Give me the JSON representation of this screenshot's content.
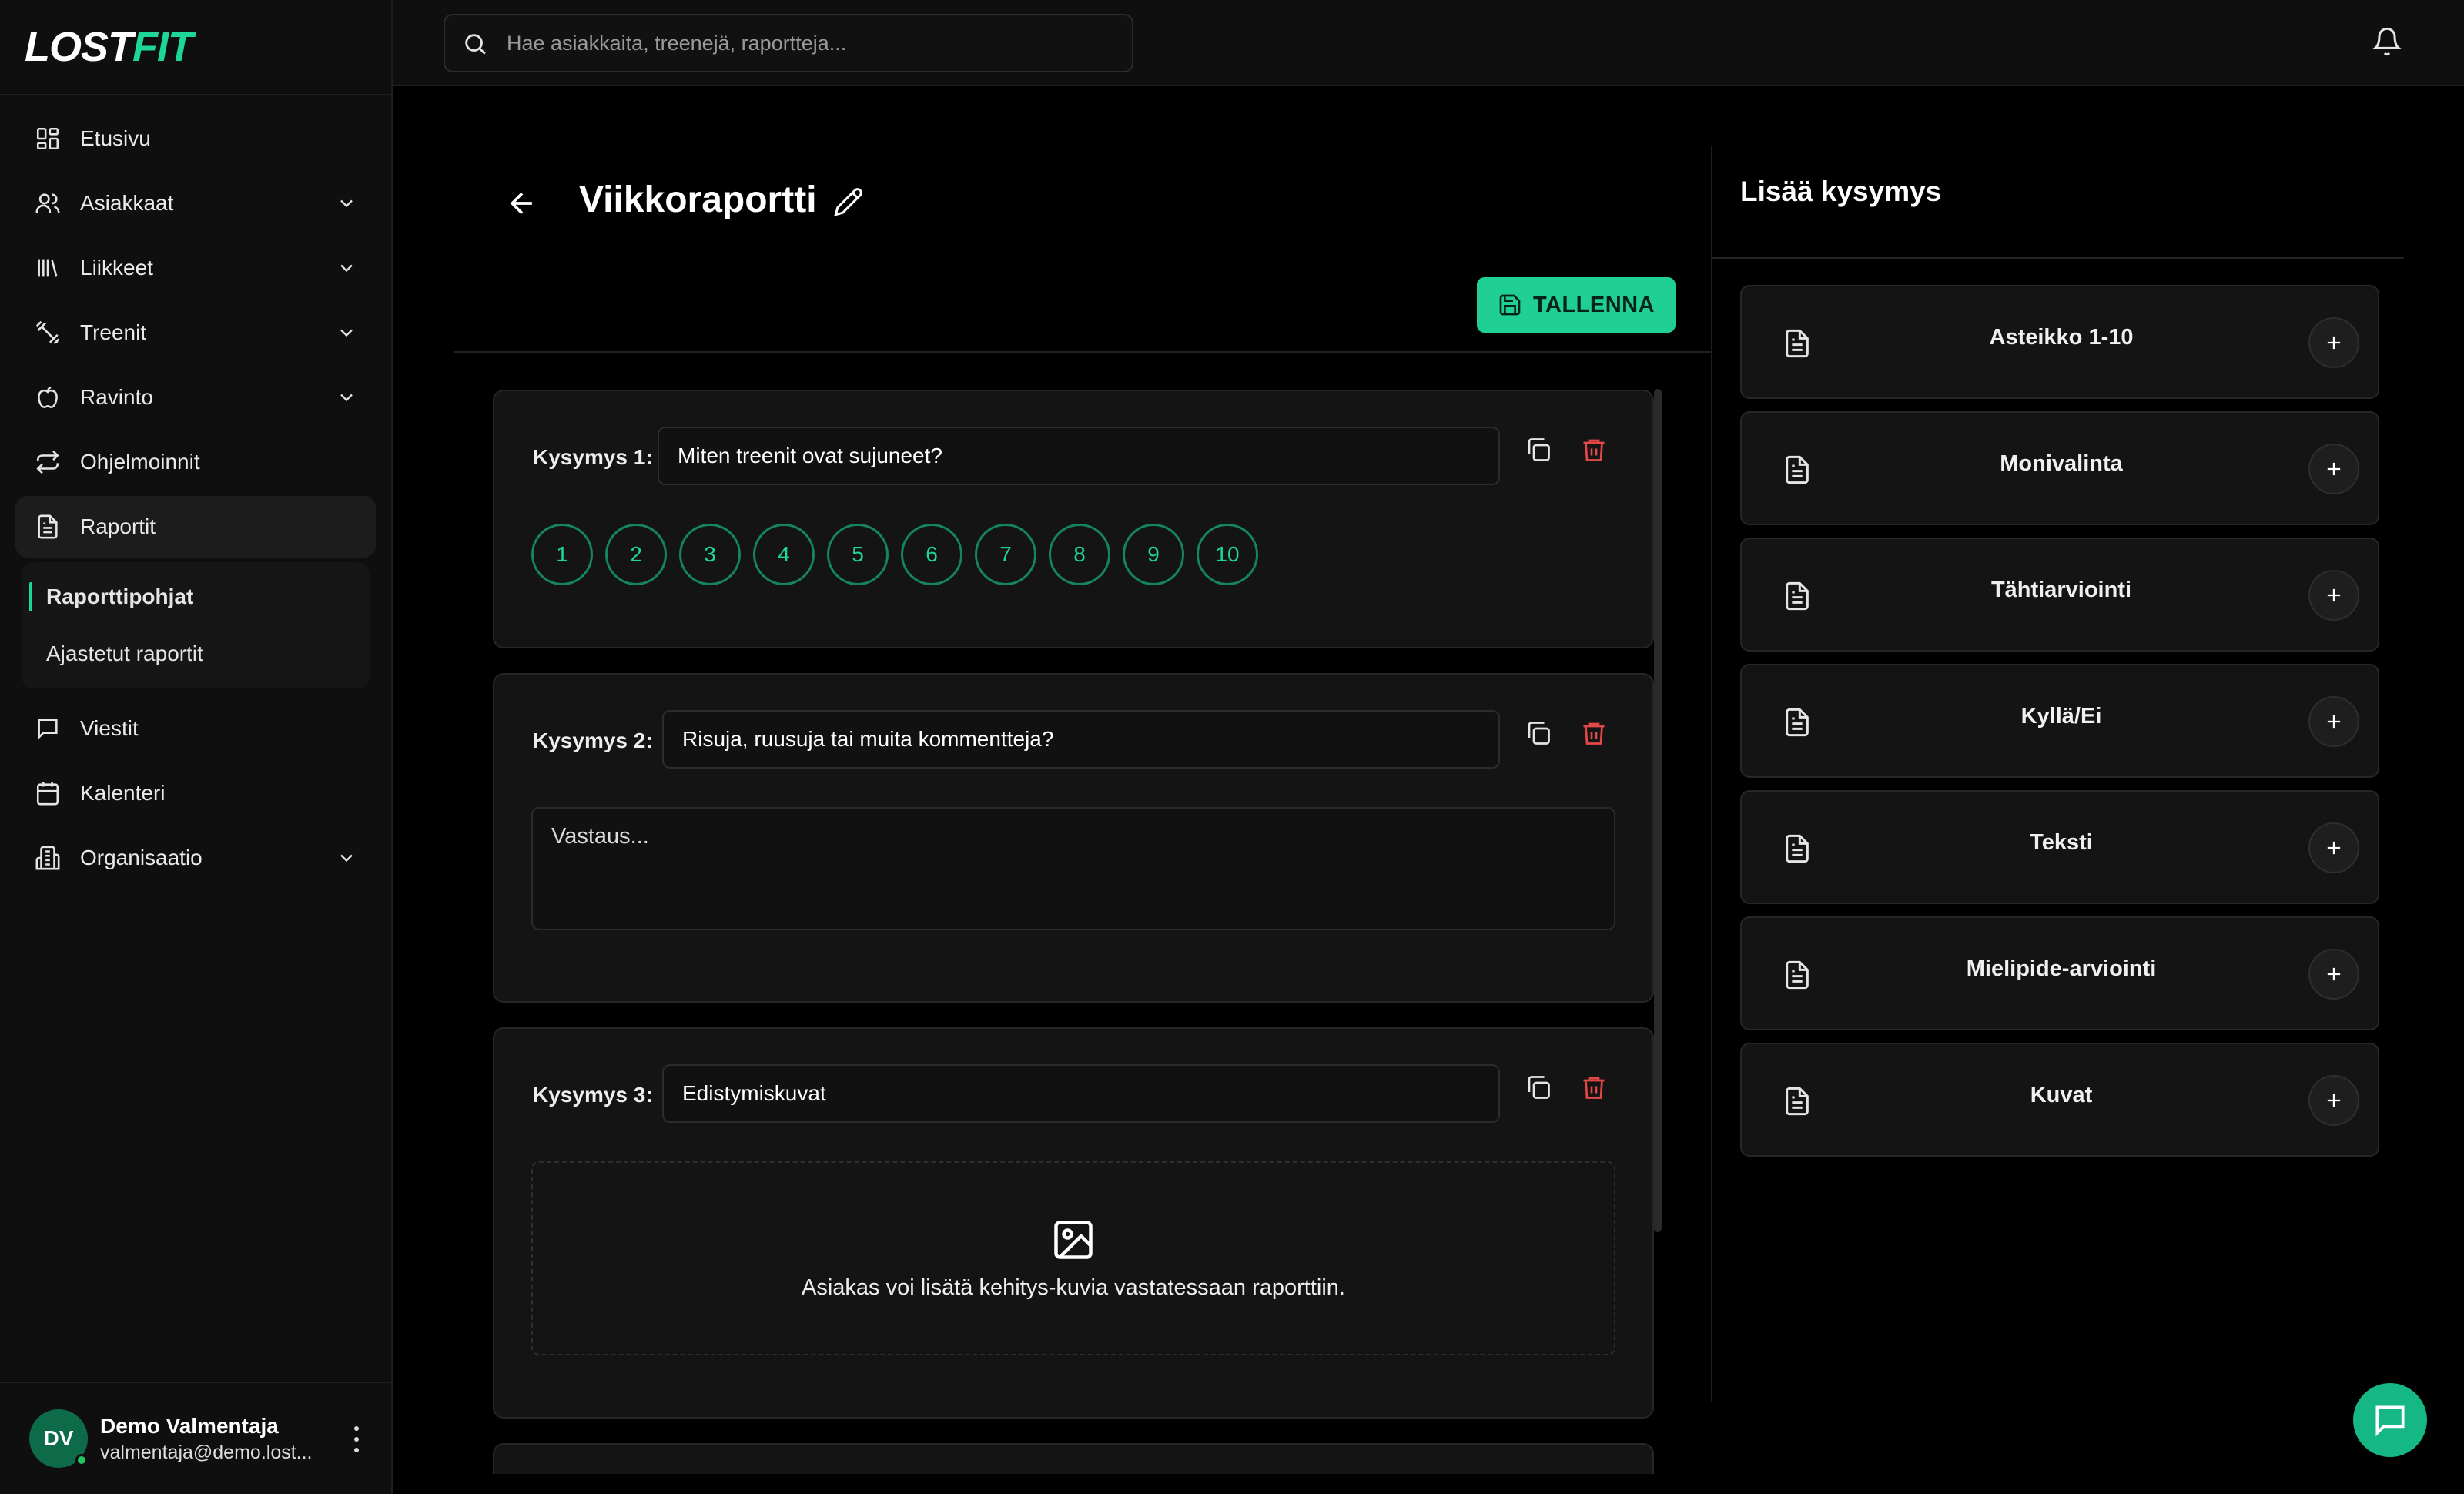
{
  "brand": {
    "lost": "LOST",
    "fit": "FIT",
    "accent": "#1fd69a"
  },
  "search": {
    "placeholder": "Hae asiakkaita, treenejä, raportteja..."
  },
  "sidebar": {
    "items": [
      {
        "label": "Etusivu",
        "icon": "dashboard-icon"
      },
      {
        "label": "Asiakkaat",
        "icon": "users-icon",
        "expandable": true
      },
      {
        "label": "Liikkeet",
        "icon": "library-icon",
        "expandable": true
      },
      {
        "label": "Treenit",
        "icon": "dumbbell-icon",
        "expandable": true
      },
      {
        "label": "Ravinto",
        "icon": "apple-icon",
        "expandable": true
      },
      {
        "label": "Ohjelmoinnit",
        "icon": "repeat-icon"
      },
      {
        "label": "Raportit",
        "icon": "report-icon",
        "active": true
      },
      {
        "label": "Viestit",
        "icon": "message-icon"
      },
      {
        "label": "Kalenteri",
        "icon": "calendar-icon"
      },
      {
        "label": "Organisaatio",
        "icon": "building-icon",
        "expandable": true
      }
    ],
    "raportit_sub": [
      {
        "label": "Raporttipohjat",
        "active": true
      },
      {
        "label": "Ajastetut raportit"
      }
    ]
  },
  "user": {
    "initials": "DV",
    "name": "Demo Valmentaja",
    "email": "valmentaja@demo.lost..."
  },
  "editor": {
    "title": "Viikkoraportti",
    "save_label": "TALLENNA",
    "questions": [
      {
        "label": "Kysymys 1:",
        "value": "Miten treenit ovat sujuneet?",
        "type": "scale",
        "scale": [
          "1",
          "2",
          "3",
          "4",
          "5",
          "6",
          "7",
          "8",
          "9",
          "10"
        ]
      },
      {
        "label": "Kysymys 2:",
        "value": "Risuja, ruusuja tai muita kommentteja?",
        "type": "text",
        "placeholder": "Vastaus..."
      },
      {
        "label": "Kysymys 3:",
        "value": "Edistymiskuvat",
        "type": "images",
        "hint": "Asiakas voi lisätä kehitys-kuvia vastatessaan raporttiin."
      }
    ]
  },
  "panel": {
    "title": "Lisää kysymys",
    "types": [
      "Asteikko 1-10",
      "Monivalinta",
      "Tähtiarviointi",
      "Kyllä/Ei",
      "Teksti",
      "Mielipide-arviointi",
      "Kuvat"
    ]
  }
}
